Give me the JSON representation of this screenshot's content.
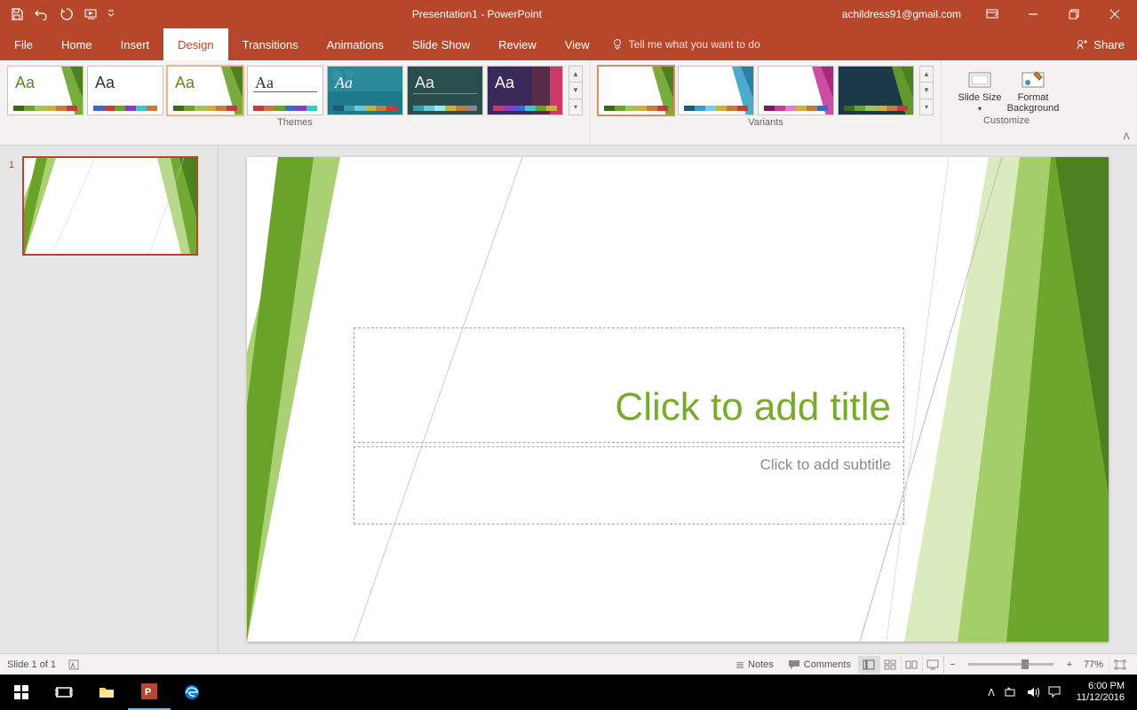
{
  "titlebar": {
    "title": "Presentation1 - PowerPoint",
    "account": "achildress91@gmail.com"
  },
  "tabs": {
    "file": "File",
    "home": "Home",
    "insert": "Insert",
    "design": "Design",
    "transitions": "Transitions",
    "animations": "Animations",
    "slideshow": "Slide Show",
    "review": "Review",
    "view": "View",
    "tellme": "Tell me what you want to do",
    "share": "Share"
  },
  "ribbon": {
    "themes_label": "Themes",
    "variants_label": "Variants",
    "customize_label": "Customize",
    "slide_size": "Slide Size",
    "format_bg": "Format Background"
  },
  "slide": {
    "title_placeholder": "Click to add title",
    "subtitle_placeholder": "Click to add subtitle"
  },
  "thumbs": {
    "slide1_num": "1"
  },
  "statusbar": {
    "slide_info": "Slide 1 of 1",
    "notes": "Notes",
    "comments": "Comments",
    "zoom": "77%"
  },
  "taskbar": {
    "time": "6:00 PM",
    "date": "11/12/2016"
  },
  "theme_thumbs": [
    {
      "aa": "Aa",
      "aa_color": "#5a8a1e",
      "bg": "#ffffff",
      "accent": "green"
    },
    {
      "aa": "Aa",
      "aa_color": "#333333",
      "bg": "#ffffff",
      "accent": "multi"
    },
    {
      "aa": "Aa",
      "aa_color": "#5a8a1e",
      "bg": "#ffffff",
      "accent": "green",
      "selected": true
    },
    {
      "aa": "Aa",
      "aa_color": "#333333",
      "bg": "#ffffff",
      "accent": "red"
    },
    {
      "aa": "Aa",
      "aa_color": "#ffffff",
      "bg": "#1e7a8a",
      "accent": "teal"
    },
    {
      "aa": "Aa",
      "aa_color": "#ffffff",
      "bg": "#2a4d4d",
      "accent": "tealdk"
    },
    {
      "aa": "Aa",
      "aa_color": "#ffffff",
      "bg": "#3a2a5a",
      "accent": "purple"
    }
  ],
  "variants": [
    {
      "color": "#6aa329",
      "sel": true
    },
    {
      "color": "#3aa0c9"
    },
    {
      "color": "#c93a9a"
    },
    {
      "color": "#1a3a4a",
      "dark": true
    }
  ]
}
